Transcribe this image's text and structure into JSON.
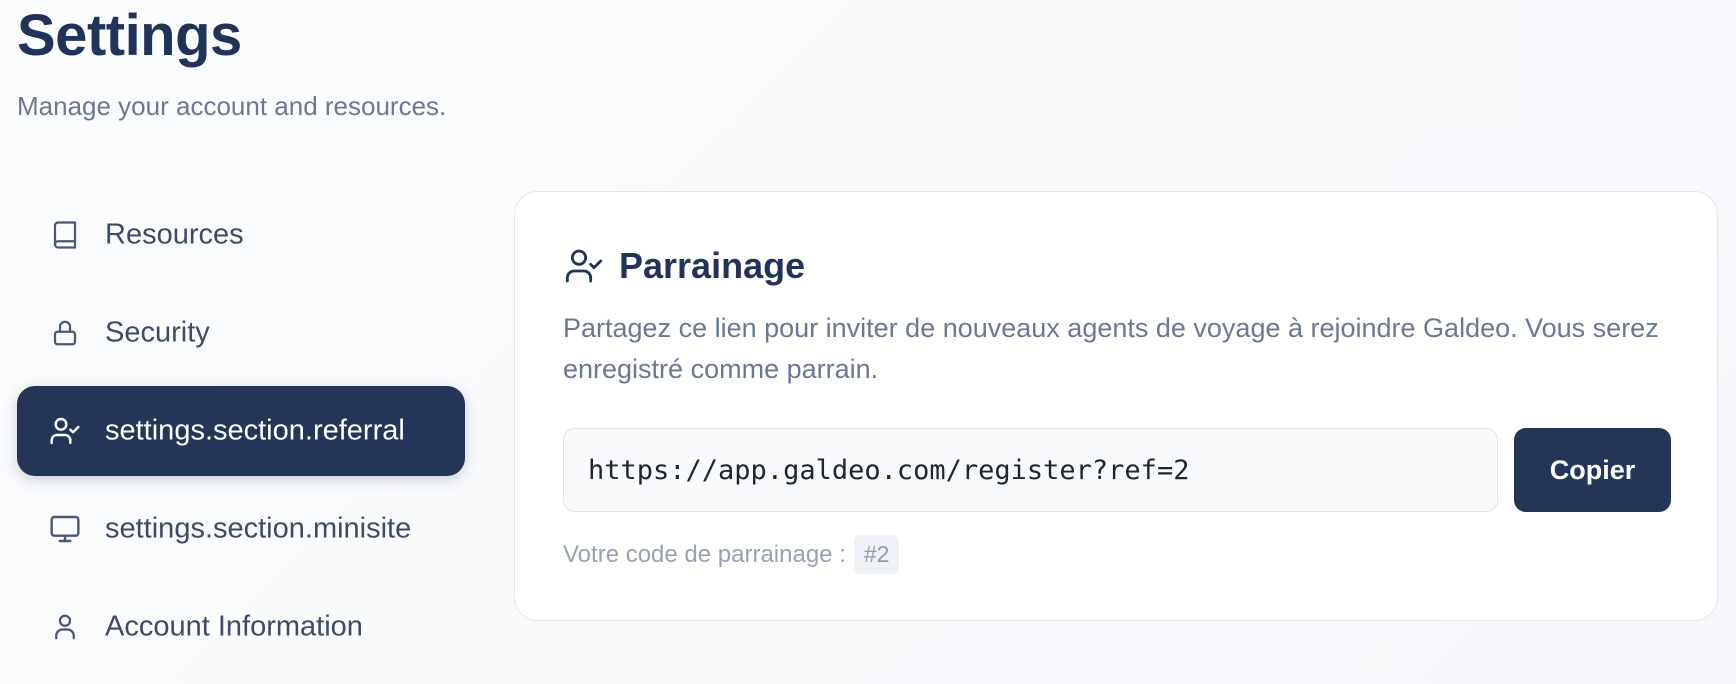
{
  "header": {
    "title": "Settings",
    "subtitle": "Manage your account and resources."
  },
  "sidebar": {
    "items": [
      {
        "label": "Resources",
        "icon": "book-icon",
        "active": false
      },
      {
        "label": "Security",
        "icon": "lock-icon",
        "active": false
      },
      {
        "label": "settings.section.referral",
        "icon": "user-check-icon",
        "active": true
      },
      {
        "label": "settings.section.minisite",
        "icon": "monitor-icon",
        "active": false
      },
      {
        "label": "Account Information",
        "icon": "user-icon",
        "active": false
      }
    ]
  },
  "referral": {
    "icon": "user-check-icon",
    "title": "Parrainage",
    "description": "Partagez ce lien pour inviter de nouveaux agents de voyage à rejoindre Galdeo. Vous serez enregistré comme parrain.",
    "link_value": "https://app.galdeo.com/register?ref=2",
    "copy_label": "Copier",
    "code_label": "Votre code de parrainage :",
    "code_value": "#2"
  },
  "colors": {
    "primary": "#243558",
    "text_muted": "#6b7891",
    "background": "#f8fafc"
  }
}
